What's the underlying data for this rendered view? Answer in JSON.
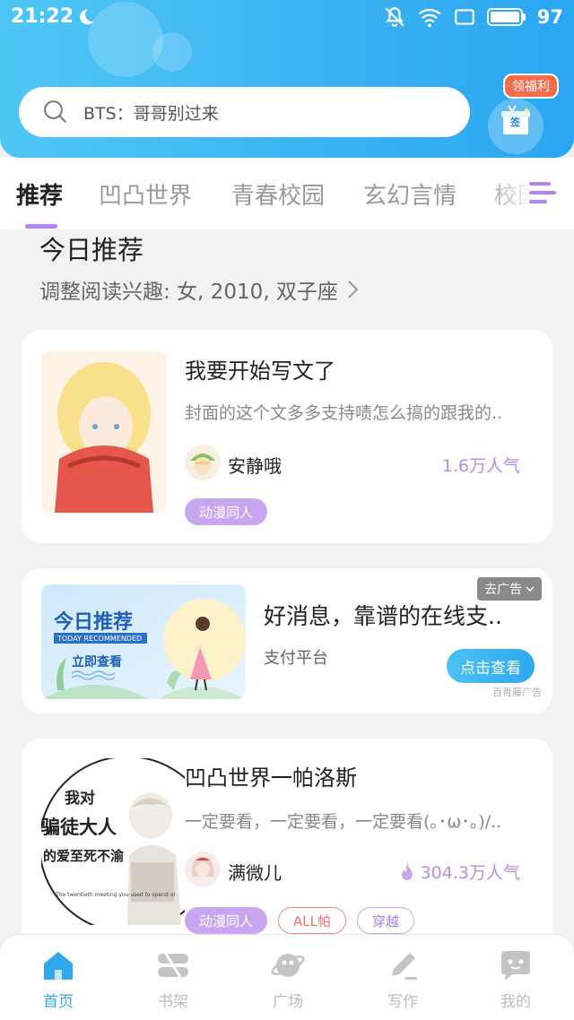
{
  "status_bar": {
    "time": "21:22",
    "battery": "97"
  },
  "search": {
    "placeholder": "BTS：哥哥别过来"
  },
  "welfare": {
    "badge": "领福利",
    "gift_label": "签"
  },
  "tabs": [
    {
      "label": "推荐",
      "active": true
    },
    {
      "label": "凹凸世界"
    },
    {
      "label": "青春校园"
    },
    {
      "label": "玄幻言情"
    },
    {
      "label": "校园"
    }
  ],
  "recommend": {
    "title": "今日推荐",
    "subtitle": "调整阅读兴趣: 女, 2010, 双子座"
  },
  "books": [
    {
      "title": "我要开始写文了",
      "desc": "封面的这个文多多支持啧怎么搞的跟我的..",
      "author": "安静哦",
      "popularity": "1.6万人气",
      "tags": [
        "动漫同人"
      ]
    },
    {
      "title": "凹凸世界一帕洛斯",
      "desc": "一定要看，一定要看，一定要看(｡･ω･｡)/..",
      "author": "满微儿",
      "popularity": "304.3万人气",
      "tags": [
        "动漫同人",
        "ALL帕",
        "穿越"
      ],
      "cover_text": [
        "我对",
        "骗徒大人",
        "的爱至死不渝",
        "The twentieth meeting you used to spend ol"
      ]
    }
  ],
  "ad": {
    "close_label": "去广告",
    "title": "好消息，靠谱的在线支..",
    "source": "支付平台",
    "button": "点击查看",
    "brand": "百青藤广告",
    "image_title": "今日推荐",
    "image_sub": "TODAY RECOMMENDED",
    "image_cta": "立即查看"
  },
  "bottom_nav": [
    {
      "label": "首页",
      "icon": "home-icon",
      "active": true
    },
    {
      "label": "书架",
      "icon": "bookshelf-icon"
    },
    {
      "label": "广场",
      "icon": "planet-icon"
    },
    {
      "label": "写作",
      "icon": "pen-icon"
    },
    {
      "label": "我的",
      "icon": "chat-bubble-icon"
    }
  ],
  "colors": {
    "accent_blue": "#2fa8ee",
    "accent_purple": "#b684f2",
    "popularity": "#b48ee6"
  }
}
